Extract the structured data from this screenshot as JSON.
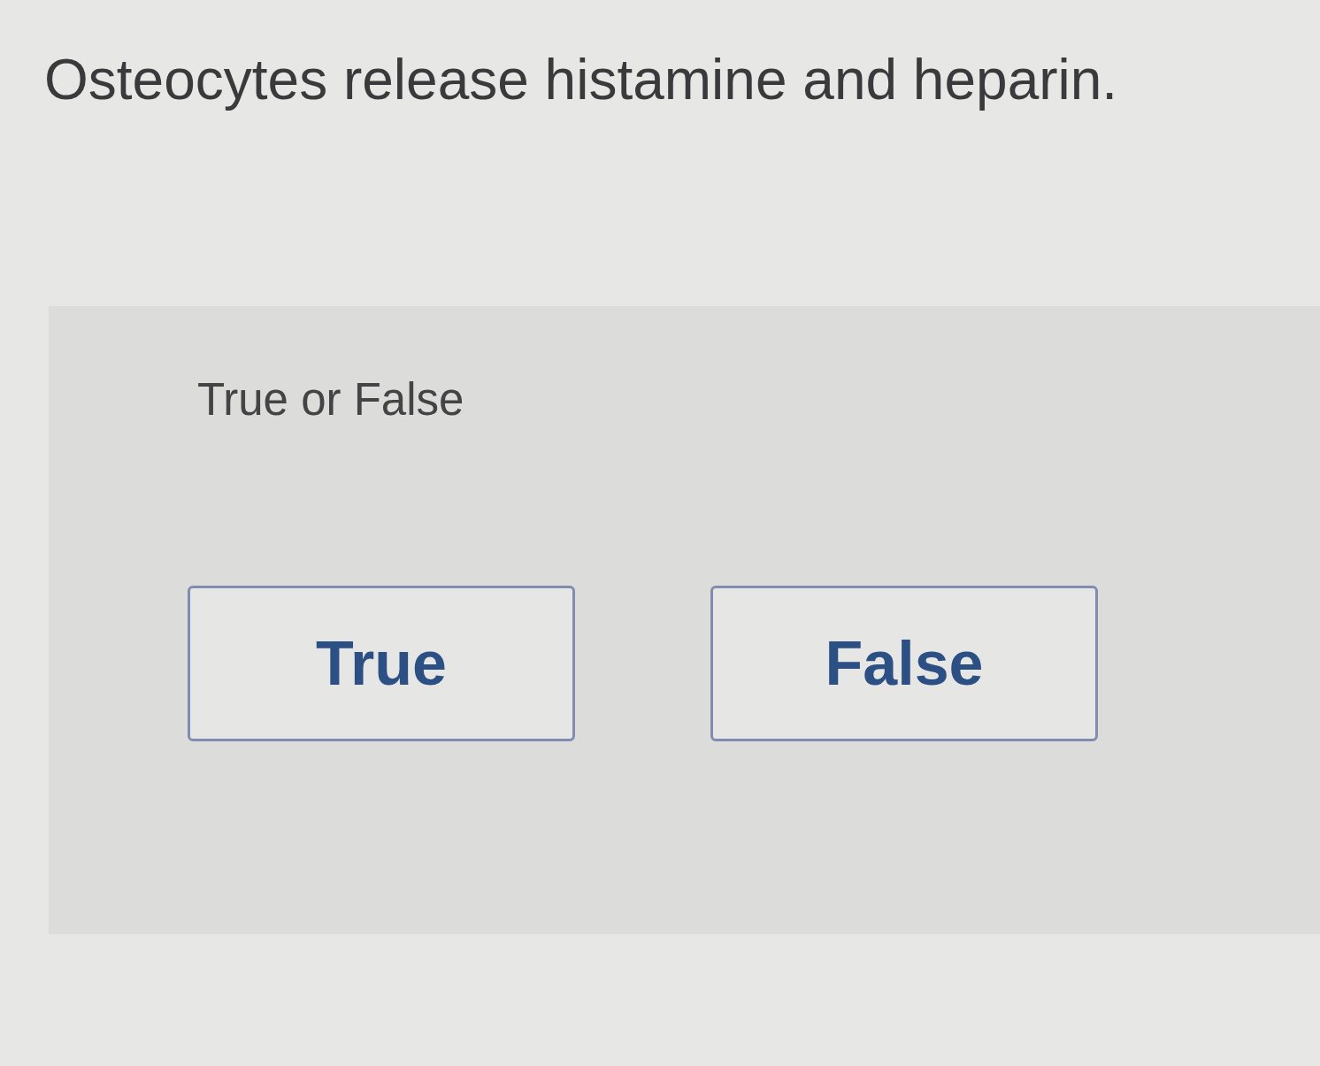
{
  "question": "Osteocytes release histamine and heparin.",
  "prompt": "True or False",
  "options": [
    {
      "label": "True",
      "selected": false
    },
    {
      "label": "False",
      "selected": false
    }
  ]
}
